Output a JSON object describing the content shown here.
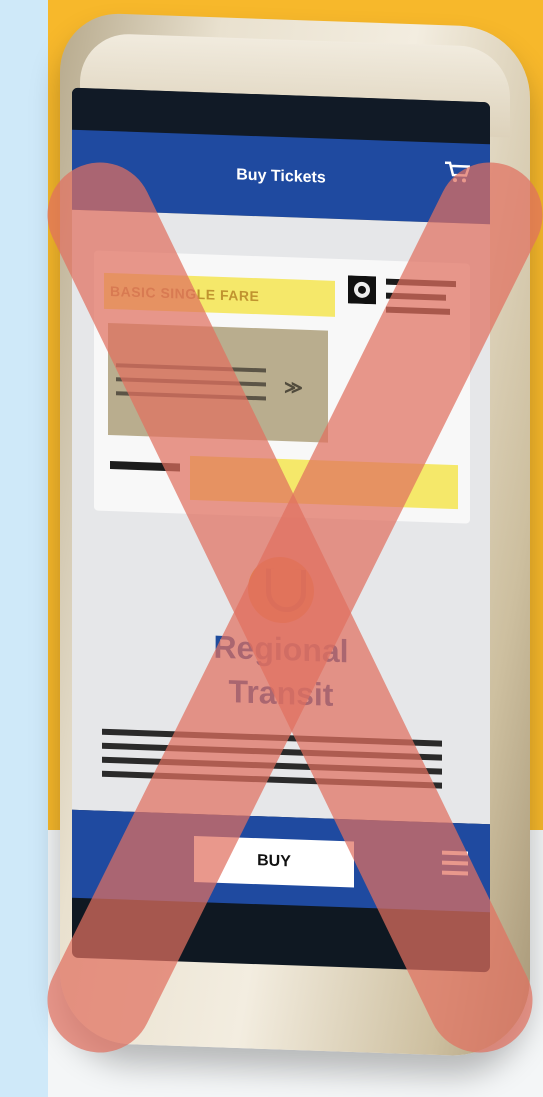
{
  "app": {
    "header_title": "Buy Tickets",
    "cart_icon": "cart-icon",
    "fare_label": "BASIC SINGLE FARE",
    "brand_line1": "Regional",
    "brand_line2": "Transit",
    "buy_label": "BUY",
    "menu_icon": "hamburger-menu-icon"
  },
  "colors": {
    "background": "#cfe9f9",
    "accent_yellow": "#f7b82b",
    "header_blue": "#1f4aa0",
    "fare_yellow": "#f5e86a",
    "overlay_red": "#e07060"
  }
}
